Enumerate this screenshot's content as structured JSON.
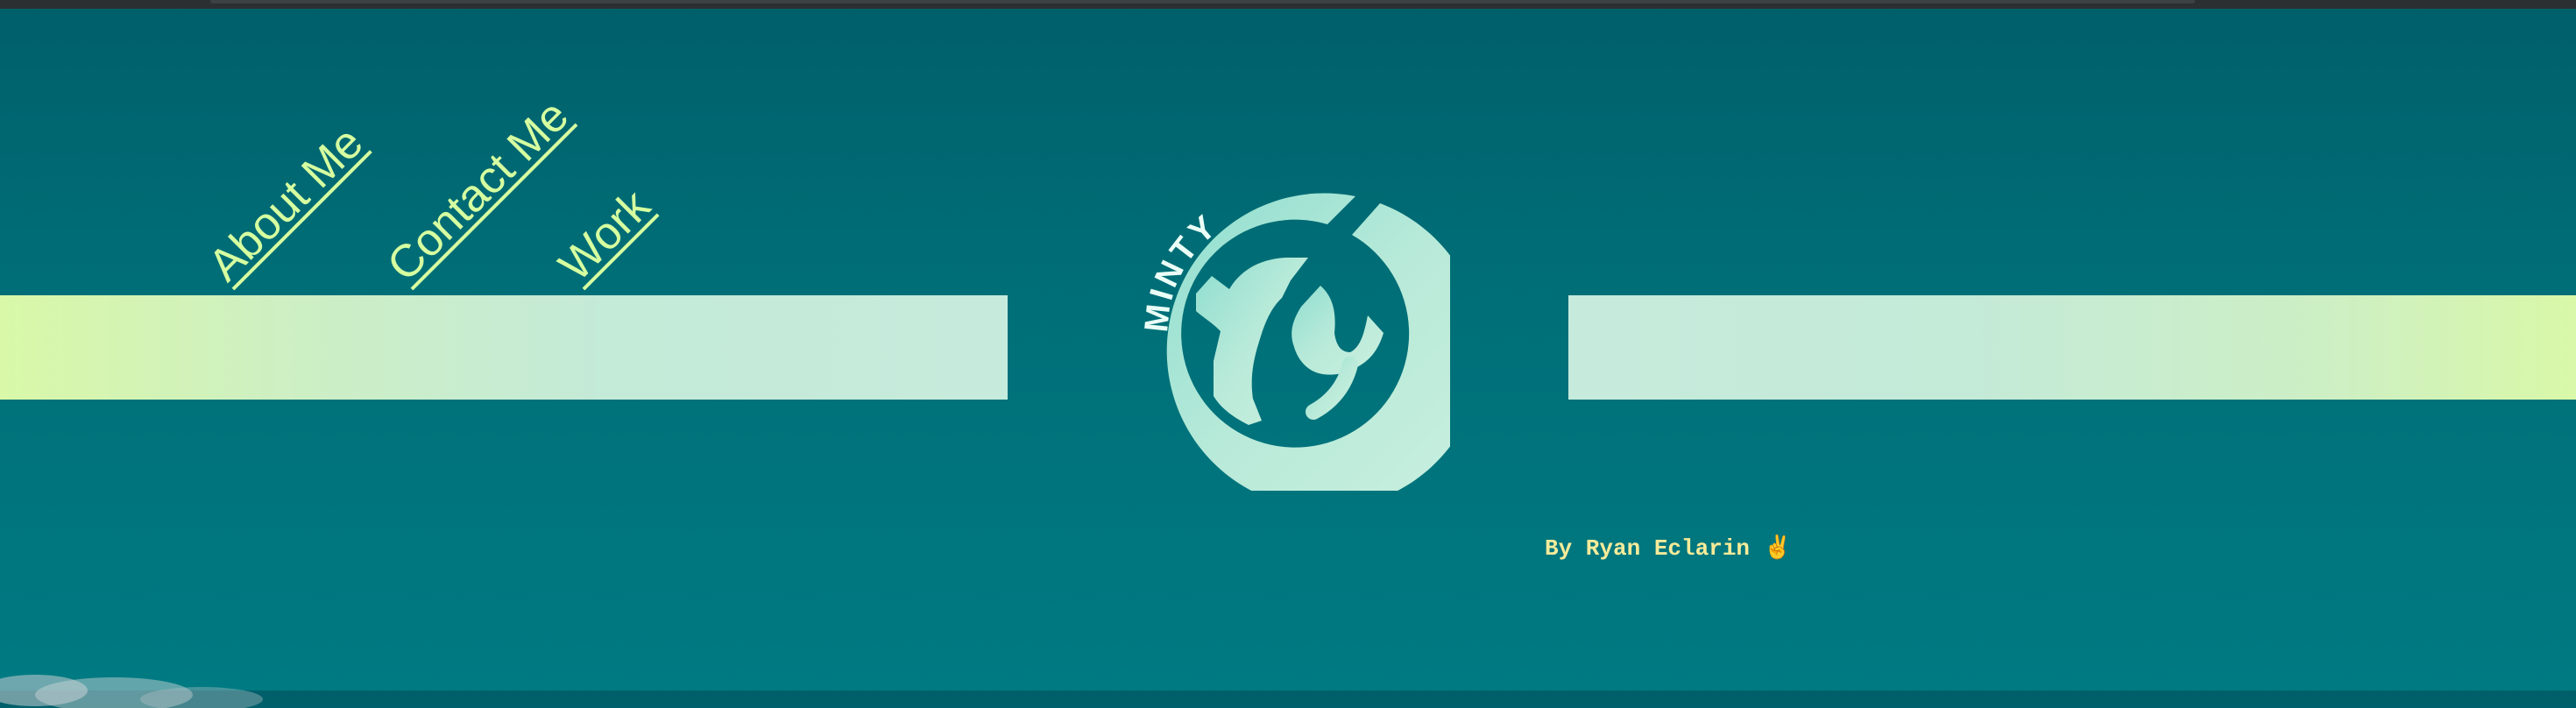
{
  "nav": {
    "about": "About Me",
    "contact": "Contact Me",
    "work": "Work"
  },
  "logo": {
    "text": "MINTY",
    "icon": "minty-ry-logo"
  },
  "byline": "By Ryan Eclarin ✌️",
  "colors": {
    "background": "#006e77",
    "band_mint": "#c6ebdc",
    "band_lime": "#d9f8a8",
    "link": "#d6ffa0",
    "byline": "#f6eb9a",
    "logo": "#b4e8d6"
  }
}
